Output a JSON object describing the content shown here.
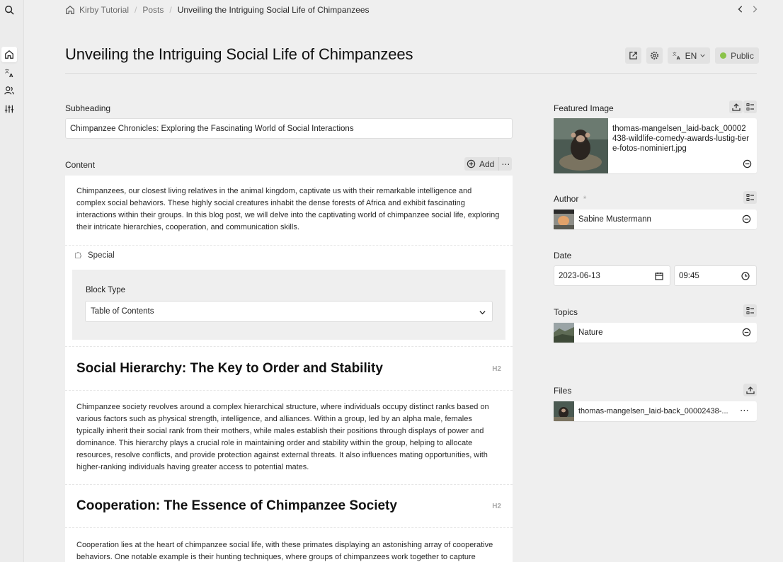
{
  "breadcrumb": {
    "site": "Kirby Tutorial",
    "section": "Posts",
    "page": "Unveiling the Intriguing Social Life of Chimpanzees"
  },
  "page": {
    "title": "Unveiling the Intriguing Social Life of Chimpanzees",
    "language": "EN",
    "status": "Public",
    "status_color": "#8bc34a"
  },
  "fields": {
    "subheading": {
      "label": "Subheading",
      "value": "Chimpanzee Chronicles: Exploring the Fascinating World of Social Interactions"
    },
    "content": {
      "label": "Content",
      "add_label": "Add",
      "more_label": "⋯"
    }
  },
  "blocks": {
    "intro": "Chimpanzees, our closest living relatives in the animal kingdom, captivate us with their remarkable intelligence and complex social behaviors. These highly social creatures inhabit the dense forests of Africa and exhibit fascinating interactions within their groups. In this blog post, we will delve into the captivating world of chimpanzee social life, exploring their intricate hierarchies, cooperation, and communication skills.",
    "special": {
      "label": "Special",
      "block_type_label": "Block Type",
      "block_type_value": "Table of Contents"
    },
    "heading1": {
      "text": "Social Hierarchy: The Key to Order and Stability",
      "tag": "H2"
    },
    "para1": "Chimpanzee society revolves around a complex hierarchical structure, where individuals occupy distinct ranks based on various factors such as physical strength, intelligence, and alliances. Within a group, led by an alpha male, females typically inherit their social rank from their mothers, while males establish their positions through displays of power and dominance. This hierarchy plays a crucial role in maintaining order and stability within the group, helping to allocate resources, resolve conflicts, and provide protection against external threats. It also influences mating opportunities, with higher-ranking individuals having greater access to potential mates.",
    "heading2": {
      "text": "Cooperation: The Essence of Chimpanzee Society",
      "tag": "H2"
    },
    "para2": "Cooperation lies at the heart of chimpanzee social life, with these primates displaying an astonishing array of cooperative behaviors. One notable example is their hunting techniques, where groups of chimpanzees work together to capture"
  },
  "sidebar_right": {
    "featured_image": {
      "label": "Featured Image",
      "filename": "thomas-mangelsen_laid-back_00002438-wildlife-comedy-awards-lustig-tiere-fotos-nominiert.jpg"
    },
    "author": {
      "label": "Author",
      "required_mark": "*",
      "name": "Sabine Mustermann"
    },
    "date": {
      "label": "Date",
      "date_value": "2023-06-13",
      "time_value": "09:45"
    },
    "topics": {
      "label": "Topics",
      "item": "Nature"
    },
    "files": {
      "label": "Files",
      "item": "thomas-mangelsen_laid-back_00002438-...",
      "more_label": "⋯"
    }
  }
}
